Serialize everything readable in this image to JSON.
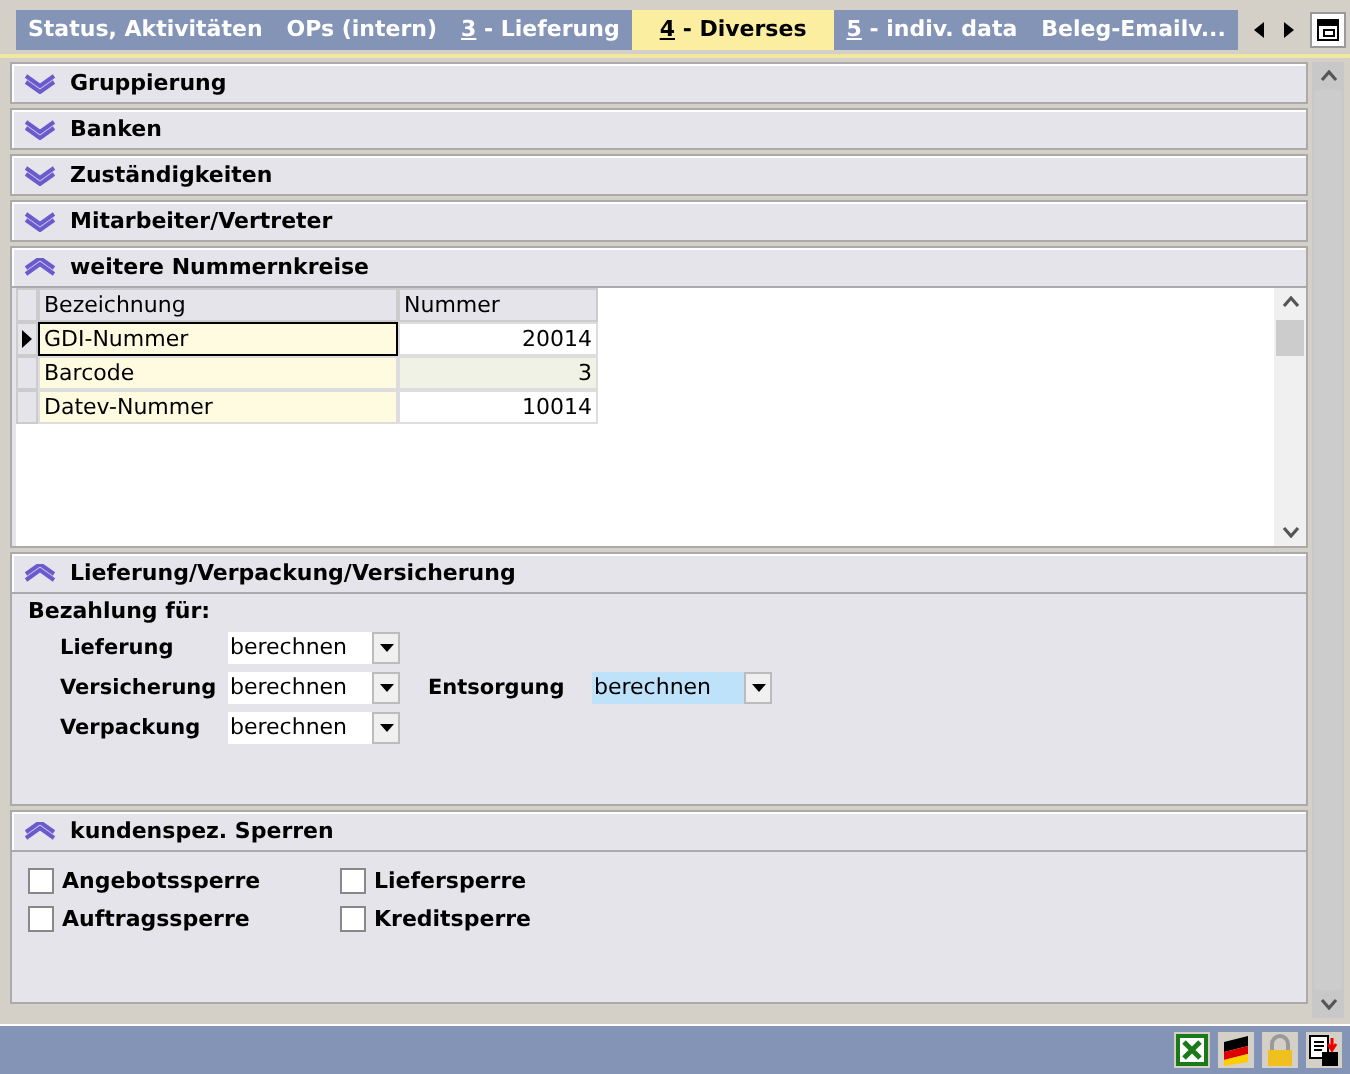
{
  "tabs": [
    {
      "label": "Status, Aktivitäten",
      "selected": false
    },
    {
      "label": "OPs (intern)",
      "selected": false
    },
    {
      "key": "3",
      "label": "- Lieferung",
      "selected": false
    },
    {
      "key": "4",
      "label": "- Diverses",
      "selected": true
    },
    {
      "key": "5",
      "label": "- indiv. data",
      "selected": false
    },
    {
      "label": "Beleg-Emailv...",
      "selected": false
    }
  ],
  "sections": [
    {
      "title": "Gruppierung",
      "expanded": false
    },
    {
      "title": "Banken",
      "expanded": false
    },
    {
      "title": "Zuständigkeiten",
      "expanded": false
    },
    {
      "title": "Mitarbeiter/Vertreter",
      "expanded": false
    },
    {
      "kind": "grid",
      "title": "weitere Nummernkreise",
      "expanded": true,
      "columns": [
        "Bezeichnung",
        "Nummer"
      ],
      "rows": [
        {
          "name": "GDI-Nummer",
          "value": "20014",
          "selected": true
        },
        {
          "name": "Barcode",
          "value": "3",
          "selected": false
        },
        {
          "name": "Datev-Nummer",
          "value": "10014",
          "selected": false
        }
      ]
    },
    {
      "kind": "payment",
      "title": "Lieferung/Verpackung/Versicherung",
      "expanded": true,
      "group": "Bezahlung für:",
      "fields": [
        {
          "label": "Lieferung",
          "value": "berechnen",
          "focused": false
        },
        {
          "label": "Versicherung",
          "value": "berechnen",
          "focused": false
        },
        {
          "label": "Entsorgung",
          "value": "berechnen",
          "focused": true
        },
        {
          "label": "Verpackung",
          "value": "berechnen",
          "focused": false
        }
      ]
    },
    {
      "kind": "checks",
      "title": "kundenspez. Sperren",
      "expanded": true,
      "checks": [
        {
          "label": "Angebotssperre",
          "checked": false
        },
        {
          "label": "Liefersperre",
          "checked": false
        },
        {
          "label": "Auftragssperre",
          "checked": false
        },
        {
          "label": "Kreditsperre",
          "checked": false
        }
      ]
    }
  ]
}
